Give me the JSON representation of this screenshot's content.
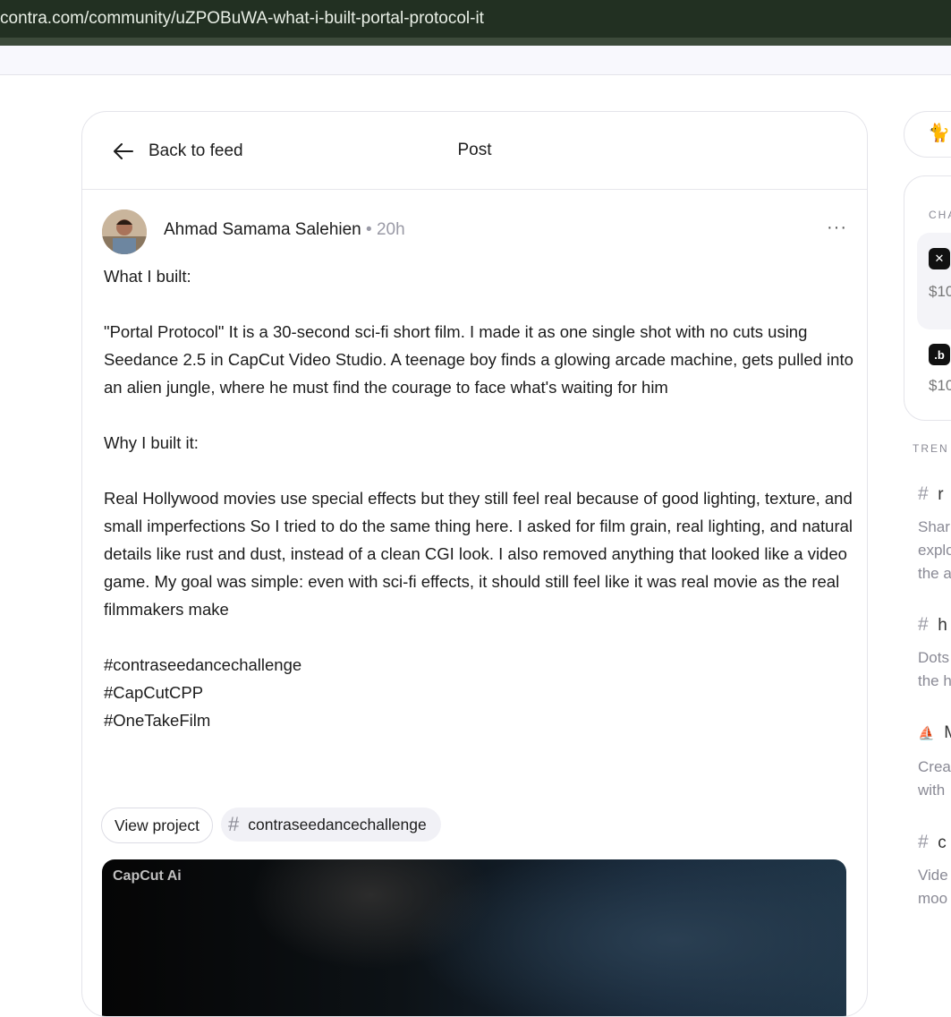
{
  "browser": {
    "url": "contra.com/community/uZPOBuWA-what-i-built-portal-protocol-it"
  },
  "header": {
    "back_label": "Back to feed",
    "title": "Post"
  },
  "post": {
    "author": "Ahmad Samama Salehien",
    "time": "• 20h",
    "more": "···",
    "paragraphs": [
      "What I built:",
      "\"Portal Protocol\" It is a 30-second sci-fi short film. I made it as one single shot with no cuts using Seedance 2.5 in CapCut Video Studio. A teenage boy finds a glowing arcade machine, gets pulled into an alien jungle, where he must find the courage to face what's waiting for him",
      "Why I built it:",
      "Real Hollywood movies use special effects but they still feel real because of good lighting, texture, and small imperfections So I tried to do the same thing here. I asked for film grain, real lighting, and natural details like rust and dust, instead of a clean CGI look. I also removed anything that looked like a video game. My goal was simple: even with sci-fi effects, it should still feel like it was real movie as the real filmmakers make"
    ],
    "hashtags": [
      "#contraseedancechallenge",
      "#CapCutCPP",
      "#OneTakeFilm"
    ],
    "view_project_label": "View project",
    "tag_hash": "#",
    "tag_label": "contraseedancechallenge",
    "video_logo": "CapCut Ai"
  },
  "sidebar": {
    "pill_icon": "🐈",
    "challenges_label": "CHA",
    "challenge_items": [
      {
        "logo": "✕",
        "price": "$10"
      },
      {
        "logo": ".b",
        "price": "$10"
      }
    ],
    "trending_label": "TREN",
    "trends": [
      {
        "icon": "#",
        "title": "r",
        "desc": [
          "Shar",
          "explo",
          "the a"
        ]
      },
      {
        "icon": "#",
        "title": "h",
        "desc": [
          "Dots",
          "the h"
        ]
      },
      {
        "icon": "⛵",
        "title": "M",
        "desc": [
          "Crea",
          "with"
        ]
      },
      {
        "icon": "#",
        "title": "c",
        "desc": [
          "Vide",
          "moo"
        ]
      }
    ]
  },
  "colors": {
    "url_bar": "#223022",
    "accent_text": "#1c1c1c",
    "muted": "#9a9aa6"
  }
}
